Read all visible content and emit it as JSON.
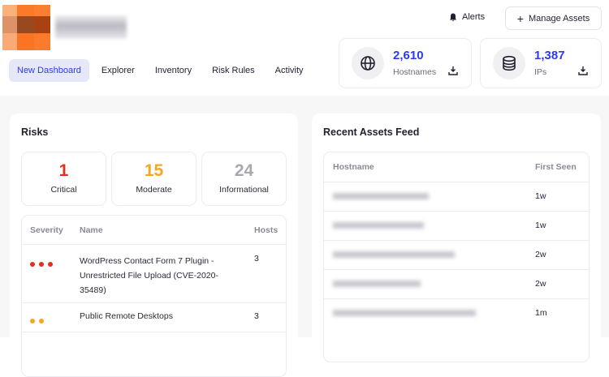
{
  "nav": {
    "items": [
      "New Dashboard",
      "Explorer",
      "Inventory",
      "Risk Rules",
      "Activity"
    ],
    "active": 0
  },
  "header": {
    "alerts": "Alerts",
    "manage_assets": "Manage Assets"
  },
  "stats": [
    {
      "value": "2,610",
      "label": "Hostnames",
      "icon": "globe-icon"
    },
    {
      "value": "1,387",
      "label": "IPs",
      "icon": "database-icon"
    }
  ],
  "risks": {
    "title": "Risks",
    "counts": [
      {
        "value": "1",
        "label": "Critical",
        "color": "#e0301e"
      },
      {
        "value": "15",
        "label": "Moderate",
        "color": "#f5a623"
      },
      {
        "value": "24",
        "label": "Informational",
        "color": "#a8a8b0"
      }
    ],
    "columns": [
      "Severity",
      "Name",
      "Hosts"
    ],
    "rows": [
      {
        "severity": 3,
        "color": "#e0301e",
        "name": "WordPress Contact Form 7 Plugin - Unrestricted File Upload (CVE-2020-35489)",
        "hosts": "3"
      },
      {
        "severity": 2,
        "color": "#f5a623",
        "name": "Public Remote Desktops",
        "hosts": "3"
      }
    ]
  },
  "feed": {
    "title": "Recent Assets Feed",
    "columns": [
      "Hostname",
      "First Seen"
    ],
    "rows": [
      {
        "first_seen": "1w"
      },
      {
        "first_seen": "1w"
      },
      {
        "first_seen": "2w"
      },
      {
        "first_seen": "2w"
      },
      {
        "first_seen": "1m"
      }
    ]
  },
  "colors": {
    "accent": "#2b3bf0",
    "active_bg": "#e6e8fa"
  }
}
